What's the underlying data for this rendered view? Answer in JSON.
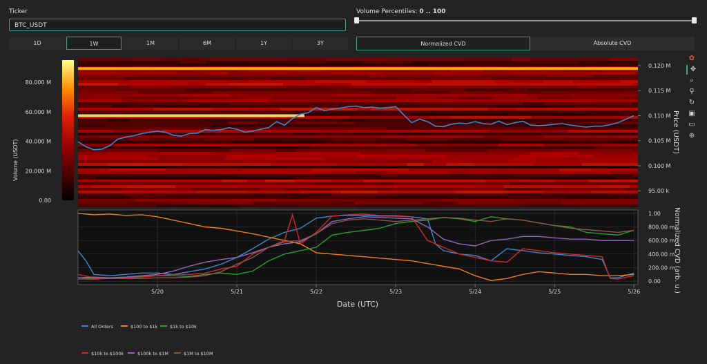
{
  "ticker": {
    "label": "Ticker",
    "value": "BTC_USDT"
  },
  "volume_percentiles": {
    "label": "Volume Percentiles:",
    "value": "0 .. 100",
    "min": 0,
    "max": 100
  },
  "time_ranges": [
    {
      "label": "1D",
      "active": false
    },
    {
      "label": "1W",
      "active": true
    },
    {
      "label": "1M",
      "active": false
    },
    {
      "label": "6M",
      "active": false
    },
    {
      "label": "1Y",
      "active": false
    },
    {
      "label": "3Y",
      "active": false
    }
  ],
  "cvd_modes": [
    {
      "label": "Normalized CVD",
      "active": true
    },
    {
      "label": "Absolute CVD",
      "active": false
    }
  ],
  "modebar_icons": [
    "plotly-logo-icon",
    "pan-icon",
    "zoom-icon",
    "zoom-in-icon",
    "reset-icon",
    "camera-icon",
    "hover-icon",
    "crosshair-icon"
  ],
  "colors": {
    "accent": "#3fa18d",
    "background": "#232323",
    "plot_bg": "#111111"
  },
  "chart_data": [
    {
      "type": "heatmap",
      "title": "",
      "colorbar": {
        "label": "Volume (USDT)",
        "ticks": [
          "0.00",
          "20.000 M",
          "40.000 M",
          "60.000 M",
          "80.000 M"
        ],
        "tick_values": [
          0,
          20000000,
          40000000,
          60000000,
          80000000
        ],
        "range": [
          0,
          95000000
        ]
      },
      "ylabel": "Price (USDT)",
      "yticks": [
        "95.00 k",
        "0.100 M",
        "0.105 M",
        "0.110 M",
        "0.115 M",
        "0.120 M"
      ],
      "ytick_values": [
        95000,
        100000,
        105000,
        110000,
        115000,
        120000
      ],
      "ylim": [
        92000,
        121500
      ],
      "xlim": [
        0,
        7.05
      ],
      "price_line": {
        "color": "#3b8bd0",
        "x": [
          0,
          0.1,
          0.2,
          0.3,
          0.4,
          0.5,
          0.6,
          0.7,
          0.8,
          0.9,
          1.0,
          1.1,
          1.2,
          1.3,
          1.4,
          1.5,
          1.6,
          1.7,
          1.8,
          1.9,
          2.0,
          2.1,
          2.2,
          2.3,
          2.4,
          2.5,
          2.6,
          2.7,
          2.8,
          2.9,
          3.0,
          3.1,
          3.2,
          3.3,
          3.4,
          3.5,
          3.6,
          3.7,
          3.8,
          3.9,
          4.0,
          4.1,
          4.2,
          4.3,
          4.4,
          4.5,
          4.6,
          4.7,
          4.8,
          4.9,
          5.0,
          5.1,
          5.2,
          5.3,
          5.4,
          5.5,
          5.6,
          5.7,
          5.8,
          5.9,
          6.0,
          6.1,
          6.2,
          6.3,
          6.4,
          6.5,
          6.6,
          6.7,
          6.8,
          6.9,
          7.0
        ],
        "y": [
          104800,
          103800,
          103200,
          103300,
          104000,
          105300,
          105700,
          106000,
          106400,
          106700,
          106900,
          106700,
          106100,
          105900,
          106400,
          106500,
          107200,
          107100,
          107200,
          107600,
          107300,
          106700,
          106900,
          107300,
          107600,
          108800,
          108100,
          109400,
          110300,
          110600,
          111600,
          111000,
          111300,
          111500,
          111800,
          111900,
          111600,
          111700,
          111500,
          111600,
          111800,
          110200,
          108600,
          109300,
          108800,
          107900,
          107800,
          108300,
          108500,
          108400,
          108800,
          108400,
          108300,
          108900,
          108200,
          108600,
          108900,
          108100,
          108000,
          108100,
          108300,
          108400,
          108100,
          107900,
          107700,
          107900,
          107900,
          108200,
          108600,
          109300,
          110000
        ]
      },
      "bright_bands": [
        {
          "price": 119400,
          "x_start": 0,
          "x_end": 7.05,
          "intensity": 0.62
        },
        {
          "price": 110000,
          "x_start": 0,
          "x_end": 2.85,
          "intensity": 0.8
        }
      ]
    },
    {
      "type": "line",
      "title": "",
      "xlabel": "Date (UTC)",
      "ylabel": "Normalized CVD (arb. u.)",
      "categories": [
        "5/20",
        "5/21",
        "5/22",
        "5/23",
        "5/24",
        "5/25",
        "5/26"
      ],
      "category_x": [
        1,
        2,
        3,
        4,
        5,
        6,
        7
      ],
      "xlim": [
        0,
        7.05
      ],
      "ylim": [
        -0.05,
        1.05
      ],
      "yticks": [
        "0.00",
        "200.00 m",
        "400.00 m",
        "600.00 m",
        "800.00 m",
        "1.00"
      ],
      "ytick_values": [
        0,
        0.2,
        0.4,
        0.6,
        0.8,
        1.0
      ],
      "grid": true,
      "legend_position": "bottom-left",
      "series": [
        {
          "name": "All Orders",
          "color": "#3b8bd0",
          "x": [
            0,
            0.1,
            0.2,
            0.4,
            0.6,
            0.8,
            1.0,
            1.2,
            1.4,
            1.6,
            1.8,
            2.0,
            2.2,
            2.4,
            2.6,
            2.8,
            3.0,
            3.2,
            3.4,
            3.6,
            3.8,
            4.0,
            4.2,
            4.4,
            4.5,
            4.6,
            4.8,
            5.0,
            5.2,
            5.4,
            5.6,
            5.8,
            6.0,
            6.2,
            6.4,
            6.6,
            6.7,
            6.8,
            7.0
          ],
          "y": [
            0.45,
            0.3,
            0.1,
            0.08,
            0.1,
            0.12,
            0.12,
            0.1,
            0.14,
            0.18,
            0.25,
            0.35,
            0.48,
            0.62,
            0.72,
            0.78,
            0.93,
            0.96,
            0.97,
            0.97,
            0.96,
            0.96,
            0.95,
            0.92,
            0.55,
            0.45,
            0.4,
            0.38,
            0.3,
            0.48,
            0.45,
            0.42,
            0.4,
            0.38,
            0.36,
            0.32,
            0.05,
            0.05,
            0.12
          ]
        },
        {
          "name": "$100 to $1k",
          "color": "#f07f18",
          "x": [
            0,
            0.2,
            0.4,
            0.6,
            0.8,
            1.0,
            1.2,
            1.4,
            1.6,
            1.8,
            2.0,
            2.2,
            2.4,
            2.6,
            2.8,
            3.0,
            3.2,
            3.4,
            3.6,
            3.8,
            4.0,
            4.2,
            4.4,
            4.6,
            4.8,
            5.0,
            5.2,
            5.4,
            5.6,
            5.8,
            6.0,
            6.2,
            6.4,
            6.6,
            6.8,
            7.0
          ],
          "y": [
            1.0,
            0.98,
            0.99,
            0.97,
            0.98,
            0.95,
            0.9,
            0.85,
            0.8,
            0.78,
            0.74,
            0.7,
            0.65,
            0.6,
            0.55,
            0.42,
            0.4,
            0.38,
            0.36,
            0.34,
            0.32,
            0.3,
            0.26,
            0.22,
            0.18,
            0.08,
            0.01,
            0.04,
            0.1,
            0.14,
            0.12,
            0.1,
            0.1,
            0.08,
            0.08,
            0.1
          ]
        },
        {
          "name": "$1k to $10k",
          "color": "#2ca02c",
          "x": [
            0,
            0.2,
            0.4,
            0.6,
            0.8,
            1.0,
            1.2,
            1.4,
            1.6,
            1.8,
            2.0,
            2.2,
            2.4,
            2.6,
            2.8,
            3.0,
            3.2,
            3.4,
            3.6,
            3.8,
            4.0,
            4.2,
            4.4,
            4.6,
            4.8,
            5.0,
            5.2,
            5.4,
            5.6,
            5.8,
            6.0,
            6.2,
            6.4,
            6.6,
            6.8,
            7.0
          ],
          "y": [
            0.05,
            0.04,
            0.05,
            0.06,
            0.07,
            0.08,
            0.08,
            0.07,
            0.1,
            0.12,
            0.1,
            0.15,
            0.3,
            0.4,
            0.45,
            0.5,
            0.68,
            0.72,
            0.75,
            0.78,
            0.85,
            0.88,
            0.9,
            0.94,
            0.92,
            0.88,
            0.95,
            0.92,
            0.9,
            0.86,
            0.82,
            0.8,
            0.72,
            0.7,
            0.68,
            0.75
          ]
        },
        {
          "name": "$10k to $100k",
          "color": "#d62728",
          "x": [
            0,
            0.2,
            0.4,
            0.6,
            0.8,
            1.0,
            1.2,
            1.4,
            1.6,
            1.8,
            2.0,
            2.2,
            2.4,
            2.6,
            2.7,
            2.8,
            3.0,
            3.2,
            3.4,
            3.6,
            3.8,
            4.0,
            4.2,
            4.4,
            4.6,
            4.8,
            5.0,
            5.2,
            5.4,
            5.6,
            5.8,
            6.0,
            6.2,
            6.4,
            6.6,
            6.7,
            6.8,
            7.0
          ],
          "y": [
            0.1,
            0.05,
            0.04,
            0.05,
            0.06,
            0.08,
            0.1,
            0.1,
            0.12,
            0.18,
            0.22,
            0.4,
            0.5,
            0.6,
            0.98,
            0.55,
            0.72,
            0.96,
            0.98,
            0.99,
            0.97,
            0.97,
            0.95,
            0.6,
            0.5,
            0.4,
            0.35,
            0.3,
            0.28,
            0.48,
            0.45,
            0.42,
            0.4,
            0.38,
            0.36,
            0.04,
            0.03,
            0.08
          ]
        },
        {
          "name": "$100k to $1M",
          "color": "#9467bd",
          "x": [
            0,
            0.2,
            0.4,
            0.6,
            0.8,
            1.0,
            1.2,
            1.4,
            1.6,
            1.8,
            2.0,
            2.2,
            2.4,
            2.6,
            2.8,
            3.0,
            3.2,
            3.4,
            3.6,
            3.8,
            4.0,
            4.2,
            4.4,
            4.6,
            4.8,
            5.0,
            5.2,
            5.4,
            5.6,
            5.8,
            6.0,
            6.2,
            6.4,
            6.6,
            6.8,
            7.0
          ],
          "y": [
            0.05,
            0.06,
            0.05,
            0.06,
            0.08,
            0.1,
            0.15,
            0.22,
            0.28,
            0.32,
            0.35,
            0.42,
            0.5,
            0.55,
            0.58,
            0.7,
            0.88,
            0.92,
            0.95,
            0.94,
            0.93,
            0.92,
            0.8,
            0.62,
            0.55,
            0.52,
            0.6,
            0.62,
            0.66,
            0.66,
            0.64,
            0.62,
            0.62,
            0.6,
            0.6,
            0.6
          ]
        },
        {
          "name": "$1M to $10M",
          "color": "#8c564b",
          "x": [
            0,
            0.2,
            0.4,
            0.6,
            0.8,
            1.0,
            1.2,
            1.4,
            1.6,
            1.8,
            2.0,
            2.2,
            2.4,
            2.6,
            2.8,
            3.0,
            3.2,
            3.4,
            3.6,
            3.8,
            4.0,
            4.2,
            4.4,
            4.6,
            4.8,
            5.0,
            5.2,
            5.4,
            5.6,
            5.8,
            6.0,
            6.2,
            6.4,
            6.6,
            6.8,
            7.0
          ],
          "y": [
            0.03,
            0.03,
            0.04,
            0.04,
            0.04,
            0.05,
            0.05,
            0.06,
            0.08,
            0.14,
            0.25,
            0.35,
            0.5,
            0.58,
            0.6,
            0.7,
            0.85,
            0.9,
            0.92,
            0.9,
            0.88,
            0.9,
            0.92,
            0.94,
            0.93,
            0.9,
            0.88,
            0.92,
            0.9,
            0.86,
            0.82,
            0.78,
            0.76,
            0.74,
            0.72,
            0.75
          ]
        }
      ]
    }
  ]
}
